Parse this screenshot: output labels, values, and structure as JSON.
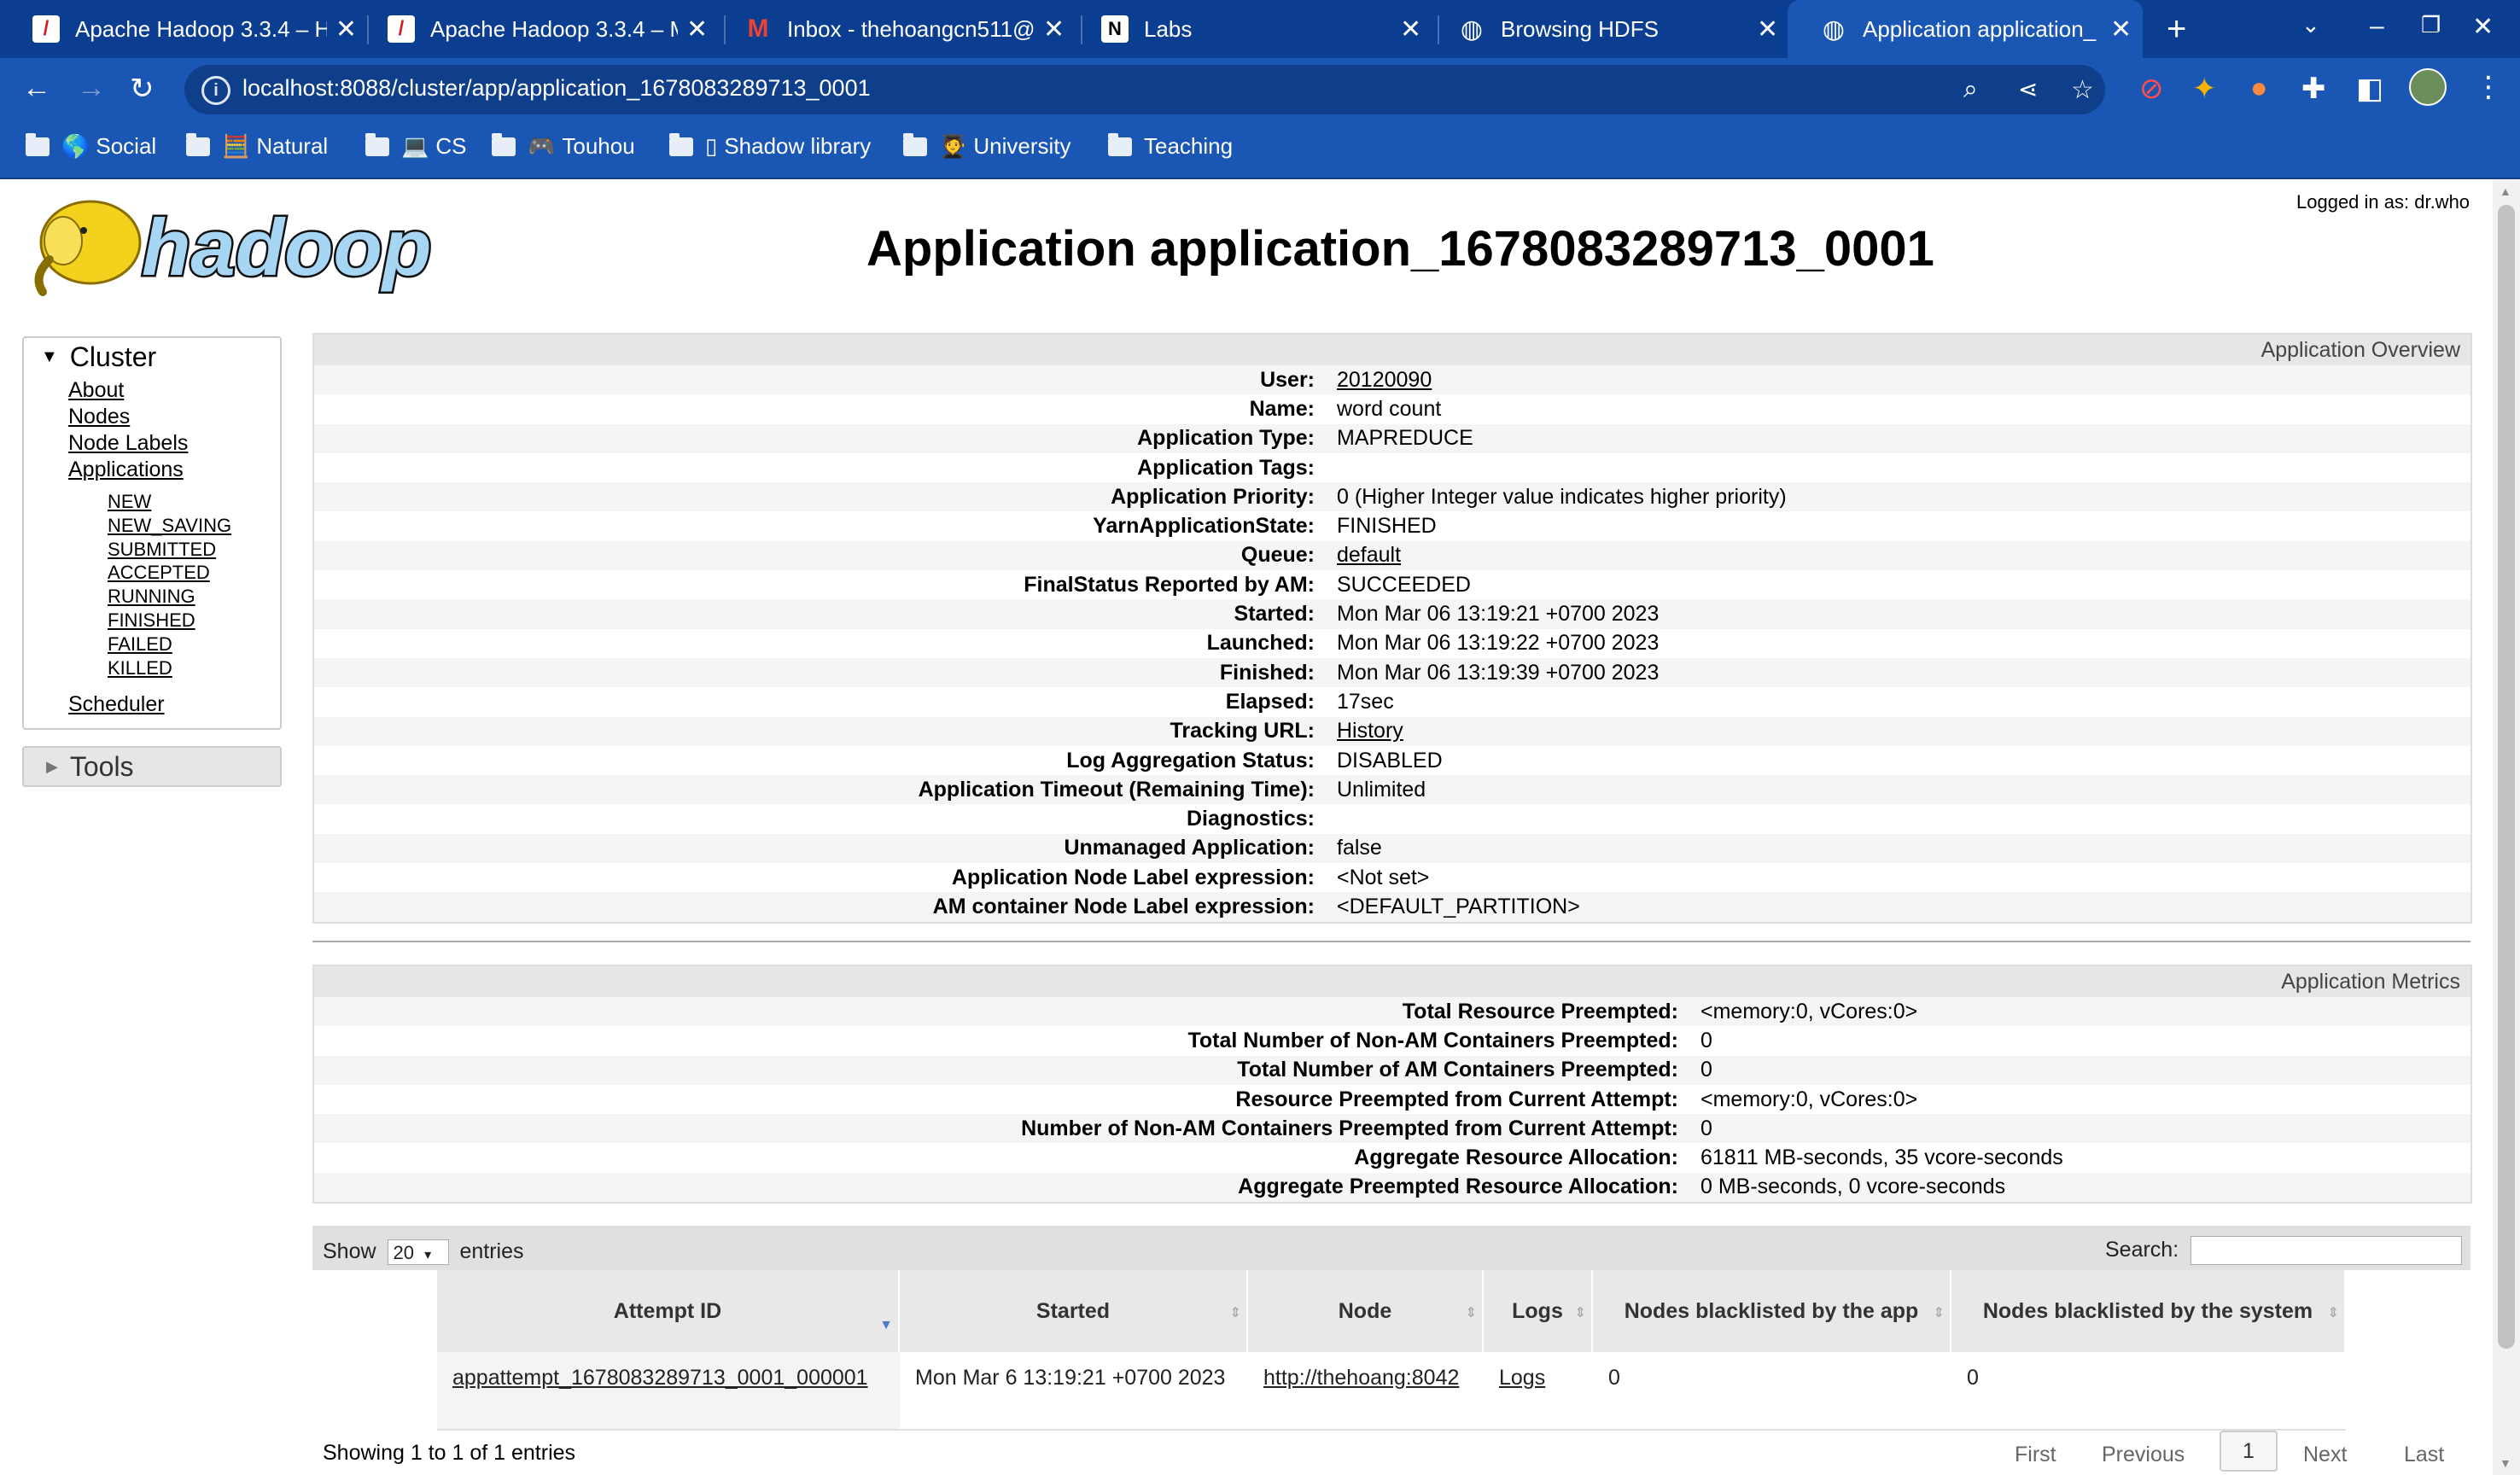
{
  "browser": {
    "tabs": [
      {
        "title": "Apache Hadoop 3.3.4 – H",
        "icon": "hadoop-doc-icon"
      },
      {
        "title": "Apache Hadoop 3.3.4 – M",
        "icon": "hadoop-doc-icon"
      },
      {
        "title": "Inbox - thehoangcn511@",
        "icon": "gmail-icon"
      },
      {
        "title": "Labs",
        "icon": "notion-icon"
      },
      {
        "title": "Browsing HDFS",
        "icon": "globe-icon"
      },
      {
        "title": "Application application_",
        "icon": "globe-icon"
      }
    ],
    "url": "localhost:8088/cluster/app/application_1678083289713_0001",
    "bookmarks": [
      {
        "label": "Social",
        "emoji": "🌎"
      },
      {
        "label": "Natural",
        "emoji": "🧮"
      },
      {
        "label": "CS",
        "emoji": "💻"
      },
      {
        "label": "Touhou",
        "emoji": "🎮"
      },
      {
        "label": "Shadow library",
        "emoji": "▯"
      },
      {
        "label": "University",
        "emoji": "🧑‍🎓"
      },
      {
        "label": "Teaching",
        "emoji": ""
      }
    ]
  },
  "page": {
    "logged_in": "Logged in as: dr.who",
    "logo_text": "hadoop",
    "title": "Application application_1678083289713_0001"
  },
  "sidebar": {
    "cluster_label": "Cluster",
    "links": [
      "About",
      "Nodes",
      "Node Labels",
      "Applications"
    ],
    "states": [
      "NEW",
      "NEW_SAVING",
      "SUBMITTED",
      "ACCEPTED",
      "RUNNING",
      "FINISHED",
      "FAILED",
      "KILLED"
    ],
    "scheduler": "Scheduler",
    "tools_label": "Tools"
  },
  "overview": {
    "heading": "Application Overview",
    "rows": [
      {
        "k": "User:",
        "v": "20120090",
        "link": true
      },
      {
        "k": "Name:",
        "v": "word count"
      },
      {
        "k": "Application Type:",
        "v": "MAPREDUCE"
      },
      {
        "k": "Application Tags:",
        "v": ""
      },
      {
        "k": "Application Priority:",
        "v": "0 (Higher Integer value indicates higher priority)"
      },
      {
        "k": "YarnApplicationState:",
        "v": "FINISHED"
      },
      {
        "k": "Queue:",
        "v": "default",
        "link": true
      },
      {
        "k": "FinalStatus Reported by AM:",
        "v": "SUCCEEDED"
      },
      {
        "k": "Started:",
        "v": "Mon Mar 06 13:19:21 +0700 2023"
      },
      {
        "k": "Launched:",
        "v": "Mon Mar 06 13:19:22 +0700 2023"
      },
      {
        "k": "Finished:",
        "v": "Mon Mar 06 13:19:39 +0700 2023"
      },
      {
        "k": "Elapsed:",
        "v": "17sec"
      },
      {
        "k": "Tracking URL:",
        "v": "History",
        "link": true
      },
      {
        "k": "Log Aggregation Status:",
        "v": "DISABLED"
      },
      {
        "k": "Application Timeout (Remaining Time):",
        "v": "Unlimited"
      },
      {
        "k": "Diagnostics:",
        "v": ""
      },
      {
        "k": "Unmanaged Application:",
        "v": "false"
      },
      {
        "k": "Application Node Label expression:",
        "v": "<Not set>"
      },
      {
        "k": "AM container Node Label expression:",
        "v": "<DEFAULT_PARTITION>"
      }
    ]
  },
  "metrics": {
    "heading": "Application Metrics",
    "rows": [
      {
        "k": "Total Resource Preempted:",
        "v": "<memory:0, vCores:0>"
      },
      {
        "k": "Total Number of Non-AM Containers Preempted:",
        "v": "0"
      },
      {
        "k": "Total Number of AM Containers Preempted:",
        "v": "0"
      },
      {
        "k": "Resource Preempted from Current Attempt:",
        "v": "<memory:0, vCores:0>"
      },
      {
        "k": "Number of Non-AM Containers Preempted from Current Attempt:",
        "v": "0"
      },
      {
        "k": "Aggregate Resource Allocation:",
        "v": "61811 MB-seconds, 35 vcore-seconds"
      },
      {
        "k": "Aggregate Preempted Resource Allocation:",
        "v": "0 MB-seconds, 0 vcore-seconds"
      }
    ]
  },
  "attempts": {
    "show_label": "Show",
    "entries_value": "20",
    "entries_label": "entries",
    "search_label": "Search:",
    "columns": [
      "Attempt ID",
      "Started",
      "Node",
      "Logs",
      "Nodes blacklisted by the app",
      "Nodes blacklisted by the system"
    ],
    "rows": [
      [
        "appattempt_1678083289713_0001_000001",
        "Mon Mar 6 13:19:21 +0700 2023",
        "http://thehoang:8042",
        "Logs",
        "0",
        "0"
      ]
    ],
    "info": "Showing 1 to 1 of 1 entries",
    "pager": {
      "first": "First",
      "previous": "Previous",
      "current": "1",
      "next": "Next",
      "last": "Last"
    }
  }
}
